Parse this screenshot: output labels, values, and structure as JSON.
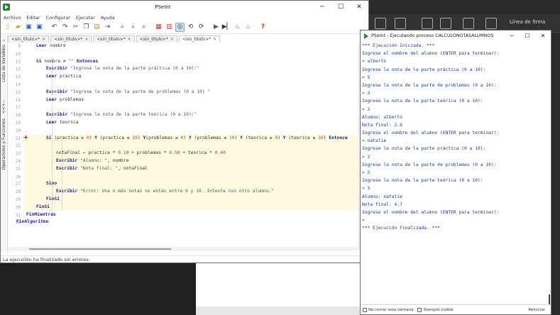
{
  "app": {
    "title": "PSeInt",
    "menu": [
      "Archivo",
      "Editar",
      "Configurar",
      "Ejecutar",
      "Ayuda"
    ],
    "tabs": [
      {
        "label": "<sin_titulo>*"
      },
      {
        "label": "<sin_titulo>*"
      },
      {
        "label": "<sin_titulo>*"
      },
      {
        "label": "<sin_titulo>*"
      },
      {
        "label": "<sin_titulo>*"
      }
    ],
    "sidebar": {
      "variables_label": "Lista de Variables",
      "ops_label": "Operadores y Funciones",
      "arrow_label": "<<+--"
    },
    "status": "La ejecución ha finalizado sin errores.",
    "code_lines": [
      {
        "n": "9",
        "text": "Leer nombre"
      },
      {
        "n": "10",
        "text": ""
      },
      {
        "n": "11",
        "text": "Si nombre ≠ \"\" Entonces"
      },
      {
        "n": "12",
        "text": "Escribir \"Ingrese la nota de la parte práctica (0 a 10):\""
      },
      {
        "n": "13",
        "text": "Leer practica"
      },
      {
        "n": "14",
        "text": ""
      },
      {
        "n": "15",
        "text": "Escribir \"Ingrese la nota de la parte de problemas (0 a 10) \""
      },
      {
        "n": "16",
        "text": "Leer problemas"
      },
      {
        "n": "17",
        "text": ""
      },
      {
        "n": "18",
        "text": "Escribir \"Ingrese la nota de la parte teórica (0 a 10):\""
      },
      {
        "n": "19",
        "text": "Leer teorica"
      },
      {
        "n": "20",
        "text": ""
      },
      {
        "n": "21",
        "text": "Si (practica ≥ 0) Y (practica ≤ 10) Y(problemas ≥ 0) Y (problemas ≤ 10) Y (teorica ≥ 0) Y (teorica ≤ 10) Entonce"
      },
      {
        "n": "22",
        "text": ""
      },
      {
        "n": "23",
        "text": "notaFinal ← practica * 0.10 + problemas * 0.50 + teorica * 0.40"
      },
      {
        "n": "24",
        "text": "Escribir \"Alumno: \", nombre"
      },
      {
        "n": "25",
        "text": "Escribir \"Nota final: \", notaFinal"
      },
      {
        "n": "26",
        "text": ""
      },
      {
        "n": "27",
        "text": "Sino"
      },
      {
        "n": "28",
        "text": "Escribir \"Error: Una o más notas no están entre 0 y 10. Intente con otro alumno.\""
      },
      {
        "n": "29",
        "text": "FinSi"
      },
      {
        "n": "30",
        "text": "FinSi"
      },
      {
        "n": "31",
        "text": "FinMientras"
      },
      {
        "n": "32",
        "text": "FinAlgoritmo"
      }
    ],
    "breakpoint_marker": "+"
  },
  "exec": {
    "title": "PSeInt - Ejecutando proceso CALCULONOTASALUMNOS",
    "console": [
      "*** Ejecución Iniciada. ***",
      "Ingrese el nombre del alumno (ENTER para terminar):",
      "> alberto",
      "Ingrese la nota de la parte práctica (0 a 10):",
      "> 5",
      "Ingrese la nota de la parte de problemas (0 a 10):",
      "> 3",
      "Ingrese la nota de la parte teórica (0 a 10):",
      "> 2",
      "Alumno: alberto",
      "Nota final: 2.8",
      "Ingrese el nombre del alumno (ENTER para terminar):",
      "> natalie",
      "Ingrese la nota de la parte práctica (0 a 10):",
      "> 2",
      "Ingrese la nota de la parte de problemas (0 a 10):",
      "> 5",
      "Ingrese la nota de la parte teórica (0 a 10):",
      "> 5",
      "Alumno: natalie",
      "Nota final: 4.7",
      "Ingrese el nombre del alumno (ENTER para terminar):",
      ">",
      "*** Ejecución Finalizada. ***"
    ],
    "footer": {
      "no_close": "No cerrar esta ventana",
      "always_visible": "Siempre visible",
      "restart": "Reiniciar"
    }
  },
  "background": {
    "ribbon_label": "Línea de firma"
  },
  "colors": {
    "accent_green": "#2f7d32",
    "keyword_blue": "#1a1a9a",
    "highlight": "#fffbe0"
  }
}
